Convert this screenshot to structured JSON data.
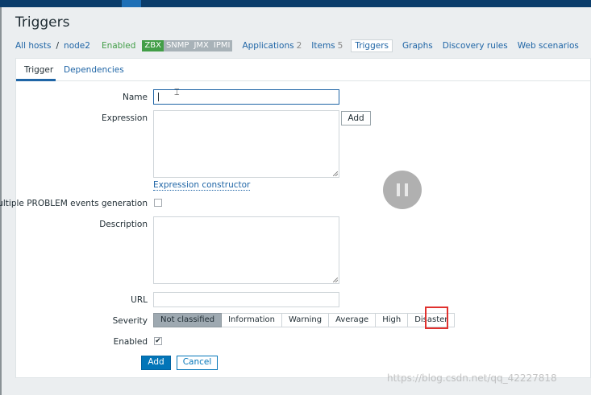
{
  "page": {
    "title": "Triggers"
  },
  "hostnav": {
    "all_hosts": "All hosts",
    "separator": "/",
    "host": "node2",
    "status": "Enabled",
    "badges": [
      "ZBX",
      "SNMP",
      "JMX",
      "IPMI"
    ],
    "items": [
      {
        "label": "Applications",
        "count": "2"
      },
      {
        "label": "Items",
        "count": "5"
      },
      {
        "label": "Triggers",
        "count": ""
      },
      {
        "label": "Graphs",
        "count": ""
      },
      {
        "label": "Discovery rules",
        "count": ""
      },
      {
        "label": "Web scenarios",
        "count": ""
      }
    ]
  },
  "tabs": {
    "trigger": "Trigger",
    "dependencies": "Dependencies"
  },
  "form": {
    "name_label": "Name",
    "name_value": "",
    "expression_label": "Expression",
    "add_expression": "Add",
    "expression_constructor": "Expression constructor",
    "multiple_problem_label": "Multiple PROBLEM events generation",
    "multiple_problem_checked": false,
    "description_label": "Description",
    "url_label": "URL",
    "url_value": "",
    "severity_label": "Severity",
    "severities": [
      "Not classified",
      "Information",
      "Warning",
      "Average",
      "High",
      "Disaster"
    ],
    "severity_selected": "Not classified",
    "enabled_label": "Enabled",
    "enabled_checked": true,
    "checkmark": "✔",
    "submit": "Add",
    "cancel": "Cancel"
  },
  "overlay": {
    "watermark": "https://blog.csdn.net/qq_42227818"
  },
  "colors": {
    "accent": "#0275b8",
    "enabled_green": "#429e47",
    "selected_severity": "#9ea9b1",
    "annotation_red": "#e0312e"
  }
}
